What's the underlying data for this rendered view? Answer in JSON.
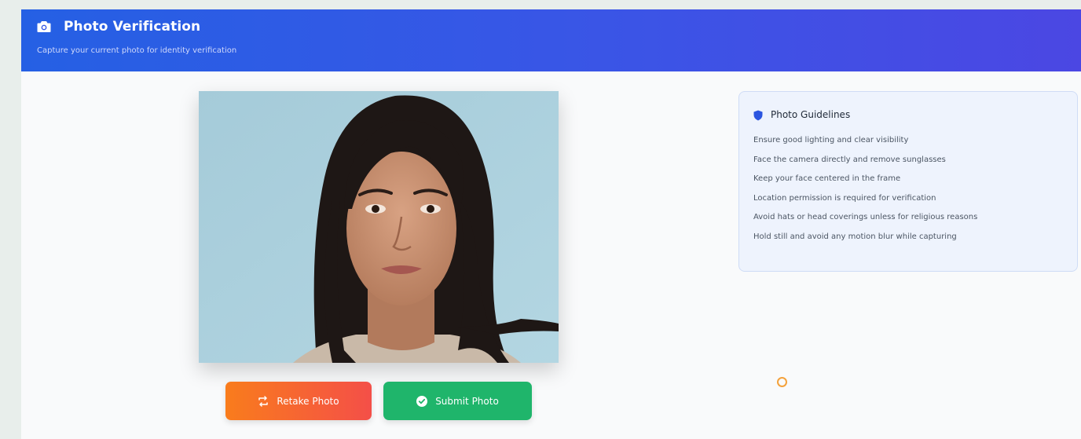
{
  "header": {
    "title": "Photo Verification",
    "subtitle": "Capture your current photo for identity verification",
    "icon": "camera-icon",
    "gradient_start": "#2560e4",
    "gradient_end": "#4b47e3"
  },
  "photo": {
    "alt": "Captured photo of the user"
  },
  "buttons": {
    "retake_label": "Retake Photo",
    "retake_icon": "repeat-icon",
    "submit_label": "Submit Photo",
    "submit_icon": "check-circle-icon",
    "retake_color": "#f97c1c",
    "submit_color": "#1fb56b"
  },
  "guidelines": {
    "title": "Photo Guidelines",
    "icon": "shield-icon",
    "items": [
      "Ensure good lighting and clear visibility",
      "Face the camera directly and remove sunglasses",
      "Keep your face centered in the frame",
      "Location permission is required for verification",
      "Avoid hats or head coverings unless for religious reasons",
      "Hold still and avoid any motion blur while capturing"
    ]
  },
  "status": {
    "loading_indicator": "spinner-icon",
    "color": "#f4a23c"
  }
}
